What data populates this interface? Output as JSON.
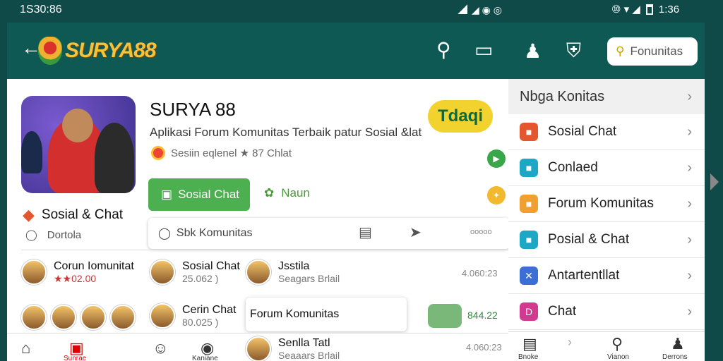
{
  "status": {
    "time_left": "1S30:86",
    "time_right": "1:36",
    "mid_icons": "◢ ◉ ◎",
    "right_icons": "⑩ ▾ ◢"
  },
  "topbar": {
    "brand": "SURYA88"
  },
  "hero": {
    "title": "SURYA 88",
    "subtitle": "Aplikasi Forum Komunitas Terbaik patur Sosial &lat",
    "meta": "Sesiin eqlenel ★ 87 Chlat",
    "pill": "Tdaqi",
    "primary_button": "Sosial Chat",
    "secondary_link": "Naun",
    "side_category": "Sosial & Chat",
    "side_sub": "Dortola",
    "search_placeholder": "Sbk Komunitas",
    "more": "ooooo"
  },
  "list": [
    {
      "name": "Corun Iomunitat",
      "sub": "★★02.00"
    },
    {
      "name": "Sosial Chat",
      "sub": "25.062 )"
    },
    {
      "name": "Jsstila",
      "sub": "Seagars Brlail"
    },
    {
      "name": "Cerin Chat",
      "sub": "80.025 )"
    },
    {
      "name": "Senlla Tatl",
      "sub": "Seaaars Brlail"
    }
  ],
  "list_right": {
    "top": "4.060:23",
    "chip_value": "844.22",
    "bottom": "4.060:23"
  },
  "float_card": "Forum Komunitas",
  "bottom_nav": {
    "active_label": "Sunrae",
    "label2": "Kaniane"
  },
  "panel": {
    "search": "Fonunitas",
    "header": "Nbga Konitas",
    "items": [
      {
        "label": "Sosial Chat",
        "color": "#e4572e"
      },
      {
        "label": "Conlaed",
        "color": "#1ea7c5"
      },
      {
        "label": "Forum Komunitas",
        "color": "#f0a030"
      },
      {
        "label": "Posial & Chat",
        "color": "#1ea7c5"
      },
      {
        "label": "Antartentllat",
        "color": "#3b6fd6"
      },
      {
        "label": "Chat",
        "color": "#d23a8f"
      }
    ],
    "bottom": {
      "l1": "Bnoke",
      "l2": "Vianon",
      "l3": "Derrons"
    }
  }
}
